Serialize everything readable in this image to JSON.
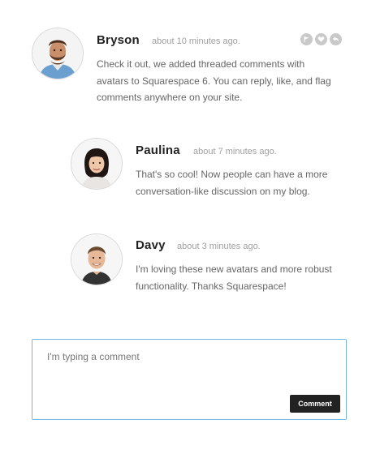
{
  "comments": [
    {
      "author": "Bryson",
      "time": "about 10 minutes ago.",
      "body": "Check it out, we added threaded comments with avatars to Squarespace 6. You can reply, like, and flag comments anywhere on your site.",
      "avatar": "bryson-avatar"
    },
    {
      "author": "Paulina",
      "time": "about 7 minutes ago.",
      "body": "That's so cool! Now people can have a more conversation-like discussion on my blog.",
      "avatar": "paulina-avatar"
    },
    {
      "author": "Davy",
      "time": "about 3 minutes ago.",
      "body": "I'm loving these new avatars and more robust functionality. Thanks Squarespace!",
      "avatar": "davy-avatar"
    }
  ],
  "actions": [
    {
      "icon": "flag-icon"
    },
    {
      "icon": "heart-icon"
    },
    {
      "icon": "reply-icon"
    }
  ],
  "composer": {
    "value": "I'm typing a comment",
    "button_label": "Comment"
  },
  "colors": {
    "accent_border": "#74b6e6",
    "button_bg": "#222222",
    "icon_bg": "#c9c9c9"
  }
}
